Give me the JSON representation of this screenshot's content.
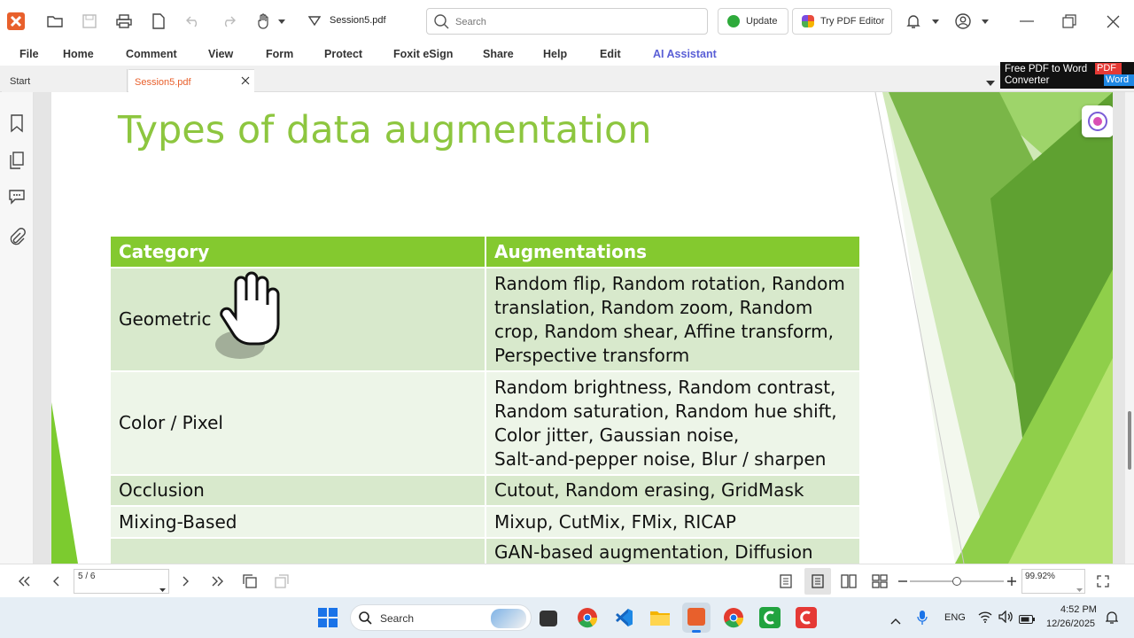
{
  "titlebar": {
    "doc_name": "Session5.pdf",
    "search_placeholder": "Search",
    "update_label": "Update",
    "try_editor_label": "Try PDF Editor"
  },
  "menu": {
    "items": [
      "File",
      "Home",
      "Comment",
      "View",
      "Form",
      "Protect",
      "Foxit eSign",
      "Share",
      "Help",
      "Edit",
      "AI Assistant"
    ]
  },
  "tabs": {
    "start_label": "Start",
    "doc_label": "Session5.pdf",
    "ad_text_1": "Free PDF to Word",
    "ad_text_2": "Converter",
    "ad_badge_1": "PDF",
    "ad_badge_2": "Word"
  },
  "slide": {
    "title": "Types of data augmentation",
    "table": {
      "headers": [
        "Category",
        "Augmentations"
      ],
      "rows": [
        {
          "category": "Geometric",
          "augmentations": [
            "Random flip, Random rotation, Random",
            "translation, Random zoom, Random",
            "crop, Random shear, Affine transform,",
            "Perspective transform"
          ]
        },
        {
          "category": "Color / Pixel",
          "augmentations": [
            "Random brightness, Random contrast,",
            "Random saturation, Random hue shift,",
            "Color jitter, Gaussian noise,",
            "Salt-and-pepper noise, Blur / sharpen"
          ]
        },
        {
          "category": "Occlusion",
          "augmentations": [
            "Cutout, Random erasing, GridMask"
          ]
        },
        {
          "category": "Mixing-Based",
          "augmentations": [
            "Mixup, CutMix, FMix, RICAP"
          ]
        },
        {
          "category": "",
          "augmentations": [
            "GAN-based augmentation, Diffusion"
          ]
        }
      ]
    }
  },
  "navbar": {
    "page_value": "5 / 6",
    "zoom_value": "99.92%"
  },
  "taskbar": {
    "search_label": "Search",
    "lang": "ENG",
    "time": "4:52 PM",
    "date": "12/26/2025"
  },
  "colors": {
    "accent_green": "#84c92f",
    "title_green": "#8dc63f",
    "menu_ai": "#5a5fd6",
    "tab_active": "#e8602c"
  }
}
